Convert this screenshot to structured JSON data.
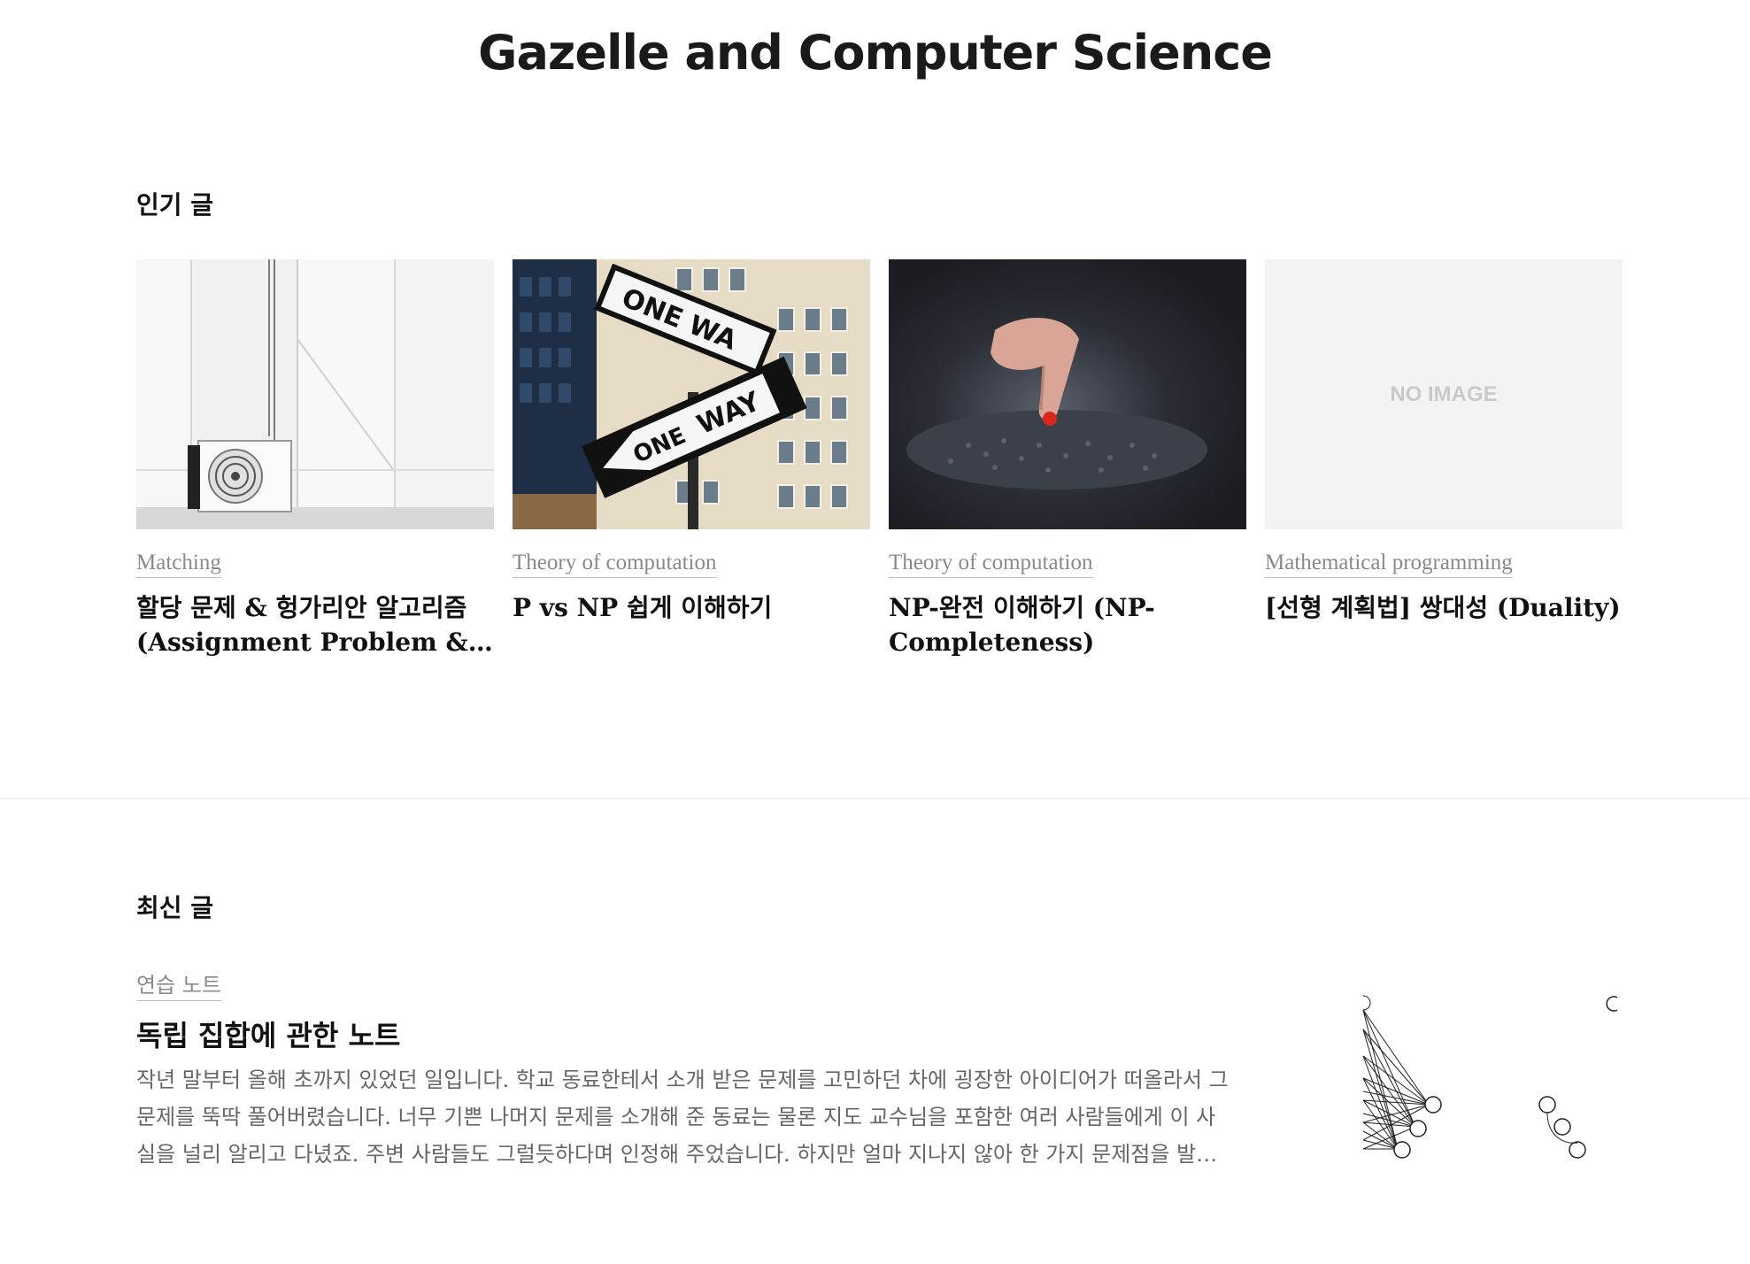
{
  "site": {
    "title": "Gazelle and Computer Science"
  },
  "popular": {
    "heading": "인기 글",
    "cards": [
      {
        "category": "Matching",
        "title": "할당 문제 & 헝가리안 알고리즘 (Assignment Problem & Hungarian Algorithm)"
      },
      {
        "category": "Theory of computation",
        "title": "P vs NP 쉽게 이해하기"
      },
      {
        "category": "Theory of computation",
        "title": "NP-완전 이해하기 (NP-Completeness)"
      },
      {
        "category": "Mathematical programming",
        "title": "[선형 계획법] 쌍대성 (Duality)",
        "no_image_label": "NO IMAGE"
      }
    ]
  },
  "recent": {
    "heading": "최신 글",
    "posts": [
      {
        "category": "연습 노트",
        "title": "독립 집합에 관한 노트",
        "excerpt": "작년 말부터 올해 초까지 있었던 일입니다. 학교 동료한테서 소개 받은 문제를 고민하던 차에 굉장한 아이디어가 떠올라서 그 문제를 뚝딱 풀어버렸습니다. 너무 기쁜 나머지 문제를 소개해 준 동료는 물론 지도 교수님을 포함한 여러 사람들에게 이 사실을 널리 알리고 다녔죠. 주변 사람들도 그럴듯하다며 인정해 주었습니다. 하지만 얼마 지나지 않아 한 가지 문제점을 발견했습니다."
      }
    ]
  },
  "thumbnails": {
    "card_0": "air-conditioner-photo",
    "card_1": "one-way-sign-photo",
    "card_2": "puzzle-hand-photo",
    "recent_0": "graph-drawing"
  }
}
